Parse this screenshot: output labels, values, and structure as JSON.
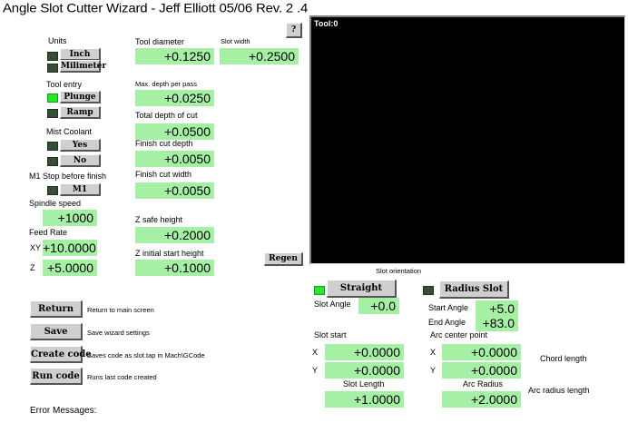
{
  "title": "Angle Slot Cutter Wizard  -  Jeff Elliott 05/06 Rev. 2 .4",
  "help_button": "?",
  "units": {
    "label": "Units",
    "inch": "Inch",
    "millimeter": "Milimeter"
  },
  "tool_entry": {
    "label": "Tool entry",
    "plunge": "Plunge",
    "ramp": "Ramp"
  },
  "mist": {
    "label": "Mist Coolant",
    "yes": "Yes",
    "no": "No"
  },
  "m1": {
    "label": "M1 Stop before finish",
    "button": "M1"
  },
  "spindle": {
    "label": "Spindle speed",
    "value": "+1000"
  },
  "feed": {
    "label": "Feed Rate",
    "xy_label": "XY",
    "xy_value": "+10.0000",
    "z_label": "Z",
    "z_value": "+5.0000"
  },
  "params": {
    "tool_diameter": {
      "label": "Tool diameter",
      "value": "+0.1250"
    },
    "slot_width": {
      "label": "Slot width",
      "value": "+0.2500"
    },
    "max_depth": {
      "label": "Max. depth per pass",
      "value": "+0.0250"
    },
    "total_depth": {
      "label": "Total depth of cut",
      "value": "+0.0500"
    },
    "finish_depth": {
      "label": "Finish cut depth",
      "value": "+0.0050"
    },
    "finish_width": {
      "label": "Finish cut width",
      "value": "+0.0050"
    },
    "z_safe": {
      "label": "Z safe height",
      "value": "+0.2000"
    },
    "z_initial": {
      "label": "Z initial start height",
      "value": "+0.1000"
    }
  },
  "display": {
    "tool_text": "Tool:0"
  },
  "regen": "Regen",
  "slot_orientation": {
    "label": "Slot orientation",
    "straight": "Straight",
    "radius": "Radius Slot",
    "slot_angle_label": "Slot Angle",
    "slot_angle_value": "+0.0",
    "start_angle_label": "Start Angle",
    "start_angle_value": "+5.0",
    "end_angle_label": "End Angle",
    "end_angle_value": "+83.0"
  },
  "slot_start": {
    "label": "Slot start",
    "x_label": "X",
    "x_value": "+0.0000",
    "y_label": "Y",
    "y_value": "+0.0000",
    "length_label": "Slot Length",
    "length_value": "+1.0000"
  },
  "arc_center": {
    "label": "Arc center point",
    "x_label": "X",
    "x_value": "+0.0000",
    "y_label": "Y",
    "y_value": "+0.0000",
    "radius_label": "Arc Radius",
    "radius_value": "+2.0000"
  },
  "chord_length": "Chord length",
  "arc_radius_length": "Arc radius length",
  "actions": [
    {
      "label": "Return",
      "desc": "Return to main screen"
    },
    {
      "label": "Save",
      "desc": "Save wizard settings"
    },
    {
      "label": "Create code",
      "desc": "Saves code as slot.tap in Mach\\GCode"
    },
    {
      "label": "Run code",
      "desc": "Runs last code created"
    }
  ],
  "error_label": "Error Messages:",
  "colors": {
    "dro_bg": "#a6f0a6",
    "led_on": "#27e827",
    "led_off": "#364e36",
    "display_bg": "#000000"
  }
}
